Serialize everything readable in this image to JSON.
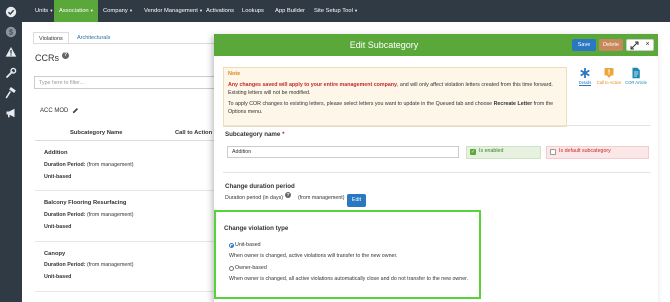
{
  "nav": {
    "items": [
      {
        "label": "Units",
        "caret": "▾"
      },
      {
        "label": "Association",
        "caret": "▾"
      },
      {
        "label": "Company",
        "caret": "▾"
      },
      {
        "label": "Vendor Management",
        "caret": "▾"
      },
      {
        "label": "Activations",
        "caret": ""
      },
      {
        "label": "Lookups",
        "caret": ""
      },
      {
        "label": "App Builder",
        "caret": ""
      },
      {
        "label": "Site Setup Tool",
        "caret": "▾"
      }
    ],
    "active_color": "#5aa83a"
  },
  "rail": {
    "icons": [
      "check-circle-icon",
      "dollar-icon",
      "warning-icon",
      "wrench-icon",
      "hammer-icon",
      "megaphone-icon"
    ]
  },
  "page": {
    "tabs": [
      "Violations",
      "Architecturals"
    ],
    "title": "CCRs",
    "filter_placeholder": "Type here to filter...",
    "section_label": "ACC MOD",
    "columns": [
      "Subcategory Name",
      "Call to Action T"
    ],
    "rows": [
      {
        "name": "Addition",
        "duration_label": "Duration Period:",
        "duration_value": "(from management)",
        "type": "Unit-based"
      },
      {
        "name": "Balcony Flooring Resurfacing",
        "duration_label": "Duration Period:",
        "duration_value": "(from management)",
        "type": "Unit-based"
      },
      {
        "name": "Canopy",
        "duration_label": "Duration Period:",
        "duration_value": "(from management)",
        "type": "Unit-based"
      }
    ]
  },
  "modal": {
    "title": "Edit Subcategory",
    "save_label": "Save",
    "delete_label": "Delete",
    "close_label": "×",
    "note": {
      "title": "Note",
      "p1_red": "Any changes saved will apply to your entire management company",
      "p1_rest": ", and will only affect violation letters created from this time forward. Existing letters will not be modified.",
      "p2_start": "To apply COR changes to existing letters, please select letters you want to update in the Queued tab and choose ",
      "p2_bold": "Recreate Letter",
      "p2_end": " from the Options menu."
    },
    "actions": [
      {
        "label": "Details",
        "icon": "asterisk-icon",
        "color": "#2b78c2"
      },
      {
        "label": "Call to Action",
        "icon": "alert-flag-icon",
        "color": "#e58a1a"
      },
      {
        "label": "COR Article",
        "icon": "document-icon",
        "color": "#1e88b5"
      }
    ],
    "subcategory": {
      "label": "Subcategory name",
      "required_mark": "*",
      "value": "Addition",
      "enabled_label": "Is enabled",
      "enabled": true,
      "default_label": "Is default subcategory",
      "is_default": false
    },
    "duration": {
      "heading": "Change duration period",
      "label": "Duration period (in days)",
      "help": "?",
      "value": "(from management)",
      "edit_label": "Edit"
    },
    "violation_type": {
      "heading": "Change violation type",
      "options": [
        {
          "label": "Unit-based",
          "desc": "When owner is changed, active violations will transfer to the new owner.",
          "selected": true
        },
        {
          "label": "Owner-based",
          "desc": "When owner is changed, all active violations automatically close and do not transfer to the new owner.",
          "selected": false
        }
      ]
    },
    "highlight_color": "#56d33b"
  }
}
